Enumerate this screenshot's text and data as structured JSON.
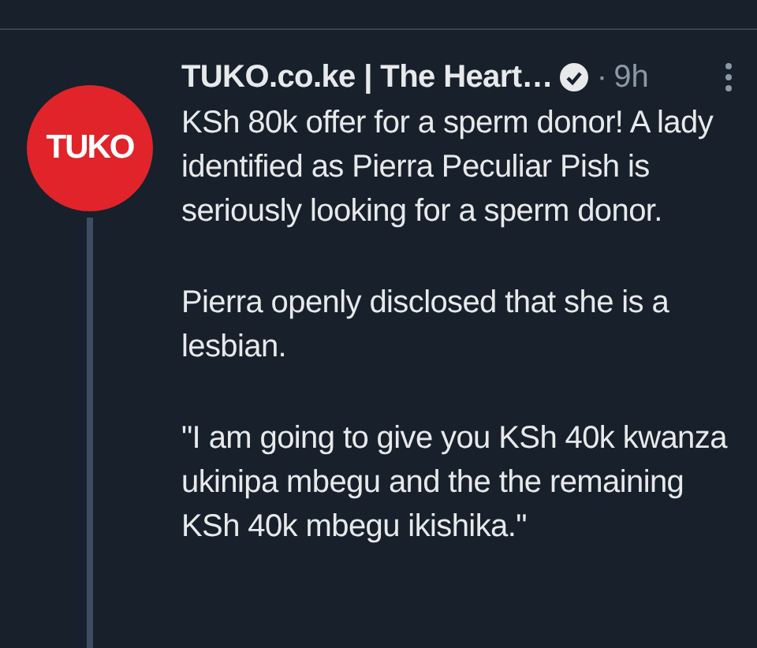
{
  "tweet": {
    "author": "TUKO.co.ke | The Heart…",
    "verified": true,
    "separator": "·",
    "time": "9h",
    "avatar_text": "TUKO",
    "paragraphs": [
      "KSh 80k offer for a sperm donor! A lady identified as Pierra Peculiar Pish is seriously looking for a sperm donor.",
      "Pierra openly disclosed that she is a lesbian.",
      "\"I am going to give you KSh 40k kwanza ukinipa mbegu and the the remaining KSh 40k mbegu ikishika.\""
    ]
  }
}
